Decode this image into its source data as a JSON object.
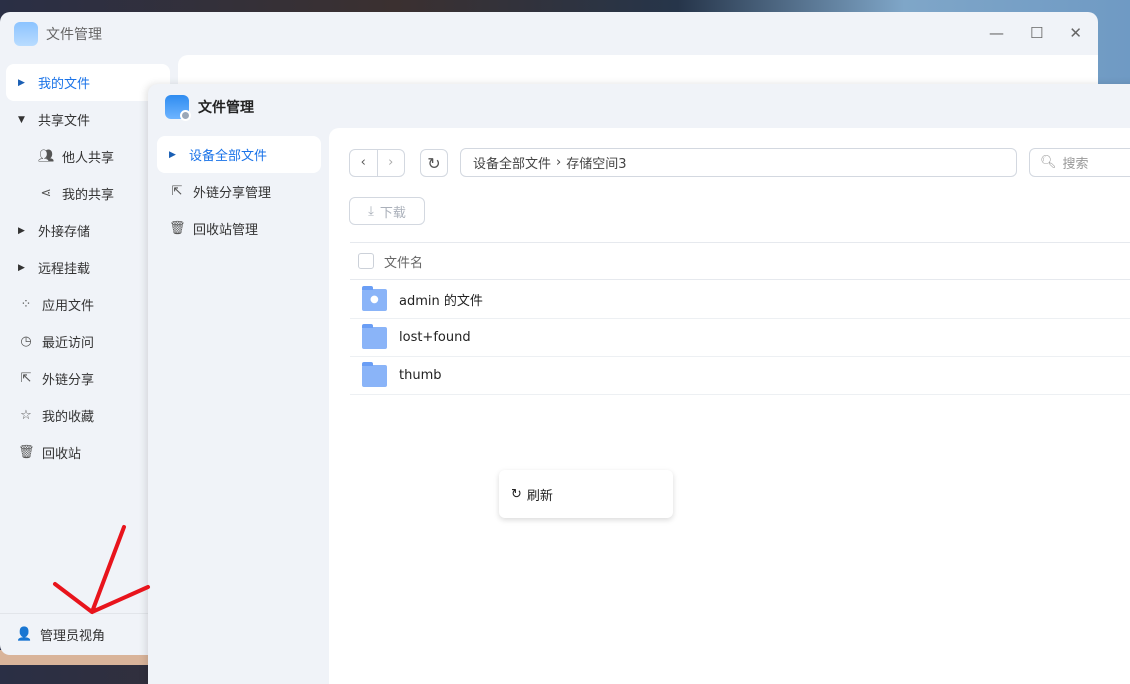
{
  "back_window": {
    "title": "文件管理",
    "controls": {
      "minimize": "—",
      "maximize": "☐",
      "close": "✕"
    },
    "sidebar": [
      {
        "label": "我的文件",
        "expander": "right",
        "active": true
      },
      {
        "label": "共享文件",
        "expander": "down"
      },
      {
        "label": "他人共享",
        "icon": "users-icon",
        "sub": true
      },
      {
        "label": "我的共享",
        "icon": "share-icon",
        "sub": true
      },
      {
        "label": "外接存储",
        "expander": "right"
      },
      {
        "label": "远程挂载",
        "expander": "right"
      },
      {
        "label": "应用文件",
        "icon": "apps-icon"
      },
      {
        "label": "最近访问",
        "icon": "clock-icon"
      },
      {
        "label": "外链分享",
        "icon": "external-share-icon"
      },
      {
        "label": "我的收藏",
        "icon": "star-icon"
      },
      {
        "label": "回收站",
        "icon": "trash-icon"
      }
    ],
    "admin_view": "管理员视角"
  },
  "front_window": {
    "title": "文件管理",
    "sidebar": [
      {
        "label": "设备全部文件",
        "active": true
      },
      {
        "label": "外链分享管理",
        "icon": "external-share-icon"
      },
      {
        "label": "回收站管理",
        "icon": "trash-icon"
      }
    ],
    "breadcrumb": [
      "设备全部文件",
      "存储空间3"
    ],
    "search_placeholder": "搜索",
    "download_label": "下载",
    "column_header": "文件名",
    "files": [
      {
        "name": "admin 的文件",
        "icon": "user-folder-icon"
      },
      {
        "name": "lost+found",
        "icon": "folder-icon"
      },
      {
        "name": "thumb",
        "icon": "folder-icon"
      }
    ],
    "context_menu": {
      "refresh": "刷新"
    }
  },
  "colors": {
    "accent": "#1a73e8",
    "folder": "#8ab4f8",
    "annotation": "#e8141c"
  }
}
